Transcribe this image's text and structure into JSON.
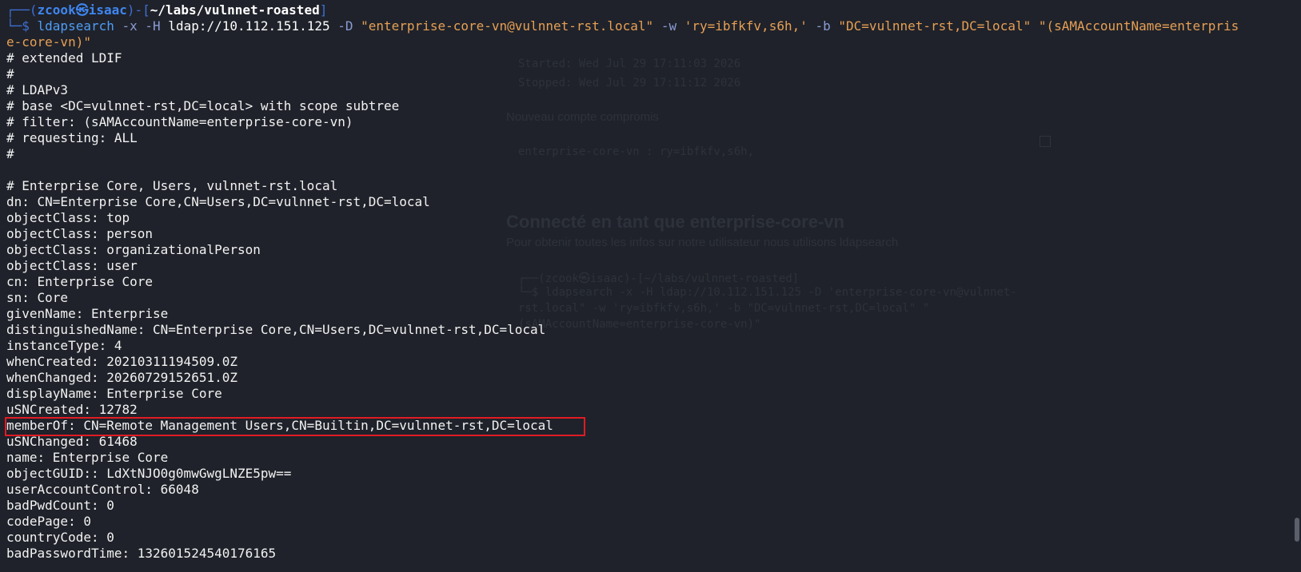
{
  "prompt": {
    "frame_open": "┌──(",
    "user": "zcook㉿isaac",
    "frame_mid": ")-[",
    "path": "~/labs/vulnnet-roasted",
    "frame_close": "]",
    "frame_second": "└─$ "
  },
  "command": {
    "name": "ldapsearch",
    "flag_x": " -x",
    "flag_H": " -H",
    "host": " ldap://10.112.151.125",
    "flag_D": " -D",
    "bind_dn": " \"enterprise-core-vn@vulnnet-rst.local\"",
    "flag_w": " -w",
    "password": " 'ry=ibfkfv,s6h,'",
    "flag_b": " -b",
    "base": " \"DC=vulnnet-rst,DC=local\"",
    "filter_open": " \"",
    "filter_line1": "(sAMAccountName=enterpris",
    "filter_line2": "e-core-vn)",
    "filter_close": "\""
  },
  "output_lines": [
    "# extended LDIF",
    "#",
    "# LDAPv3",
    "# base <DC=vulnnet-rst,DC=local> with scope subtree",
    "# filter: (sAMAccountName=enterprise-core-vn)",
    "# requesting: ALL",
    "#",
    "",
    "# Enterprise Core, Users, vulnnet-rst.local",
    "dn: CN=Enterprise Core,CN=Users,DC=vulnnet-rst,DC=local",
    "objectClass: top",
    "objectClass: person",
    "objectClass: organizationalPerson",
    "objectClass: user",
    "cn: Enterprise Core",
    "sn: Core",
    "givenName: Enterprise",
    "distinguishedName: CN=Enterprise Core,CN=Users,DC=vulnnet-rst,DC=local",
    "instanceType: 4",
    "whenCreated: 20210311194509.0Z",
    "whenChanged: 20260729152651.0Z",
    "displayName: Enterprise Core",
    "uSNCreated: 12782",
    "memberOf: CN=Remote Management Users,CN=Builtin,DC=vulnnet-rst,DC=local",
    "uSNChanged: 61468",
    "name: Enterprise Core",
    "objectGUID:: LdXtNJO0g0mwGwgLNZE5pw==",
    "userAccountControl: 66048",
    "badPwdCount: 0",
    "codePage: 0",
    "countryCode: 0",
    "badPasswordTime: 132601524540176165"
  ],
  "highlight": {
    "color": "#e01b24",
    "line_text": "memberOf: CN=Remote Management Users,CN=Builtin,DC=vulnnet-rst,DC=local"
  },
  "background_window": {
    "started": "Started: Wed Jul 29 17:11:03 2026",
    "stopped": "Stopped: Wed Jul 29 17:11:12 2026",
    "new_account_label": "Nouveau compte compromis",
    "credential": "enterprise-core-vn : ry=ibfkfv,s6h,",
    "heading": "Connecté en tant que enterprise-core-vn",
    "subtext": "Pour obtenir toutes les infos sur notre utilisateur nous utilisons ldapsearch",
    "ghost_prompt": "┌──(zcook㉿isaac)-[~/labs/vulnnet-roasted]",
    "ghost_cmd1": "└─$ ldapsearch -x -H ldap://10.112.151.125 -D 'enterprise-core-vn@vulnnet-",
    "ghost_cmd2": "rst.local\" -w 'ry=ibfkfv,s6h,' -b \"DC=vulnnet-rst,DC=local\" \"",
    "ghost_cmd3": "(sAMAccountName=enterprise-core-vn)\""
  },
  "colors": {
    "background": "#1f222a",
    "prompt_blue": "#3f86f0",
    "string_orange": "#e69f55",
    "highlight_red": "#e01b24"
  }
}
